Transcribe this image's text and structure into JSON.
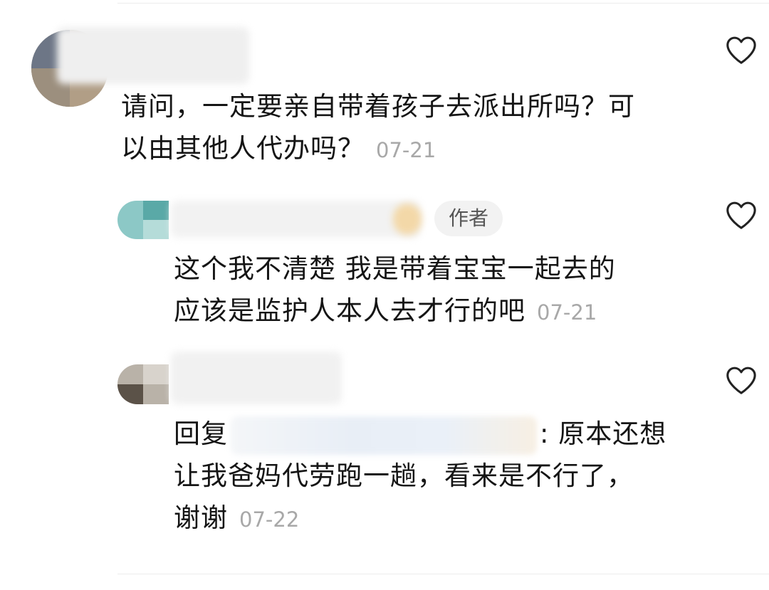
{
  "comments": [
    {
      "text_line1": "请问，一定要亲自带着孩子去派出所吗？可",
      "text_line2": "以由其他人代办吗？",
      "time": "07-21"
    },
    {
      "badge": "作者",
      "text_line1": "这个我不清楚 我是带着宝宝一起去的",
      "text_line2": "应该是监护人本人去才行的吧",
      "time": "07-21"
    },
    {
      "reply_prefix": "回复",
      "reply_suffix": ": 原本还想",
      "text_line2": "让我爸妈代劳跑一趟，看来是不行了，",
      "text_line3": "谢谢",
      "time": "07-22"
    }
  ],
  "icons": {
    "like": "heart-outline-icon"
  }
}
